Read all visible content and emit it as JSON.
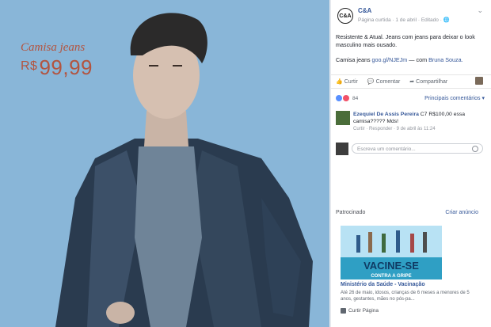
{
  "ad_photo": {
    "product_label": "Camisa jeans",
    "currency": "R$",
    "price": "99,99",
    "price_color": "#b3543f",
    "background_color": "#89b6d8"
  },
  "post": {
    "page_avatar_text": "C&A",
    "page_name": "C&A",
    "meta": "Página curtida · 1 de abril · Editado · 🌐",
    "text": "Resistente & Atual. Jeans com jeans para deixar o look masculino mais ousado.",
    "product_line": "Camisa jeans",
    "product_link": "goo.gl/NJEJm",
    "with_text": "— com",
    "with_person": "Bruna Souza.",
    "actions": [
      "Curtir",
      "Comentar",
      "Compartilhar"
    ],
    "reaction_count": "84",
    "relevant_label": "Principais comentários ▾"
  },
  "comment": {
    "author": "Ezequiel De Assis Pereira",
    "text": "C7 R$100,00 essa camisa????? Mds!",
    "meta": "Curtir · Responder · 9 de abril às 11:24"
  },
  "write_comment": {
    "placeholder": "Escreva um comentário..."
  },
  "sponsored": {
    "heading": "Patrocinado",
    "create_ad": "Criar anúncio",
    "ad_image_text": "VACINE-SE",
    "ad_image_subtext": "CONTRA A GRIPE",
    "title": "Ministério da Saúde - Vacinação",
    "description": "Até 26 de maio, idosos, crianças de 6 meses a menores de 5 anos, gestantes, mães no pós-pa...",
    "like_label": "Curtir Página"
  }
}
